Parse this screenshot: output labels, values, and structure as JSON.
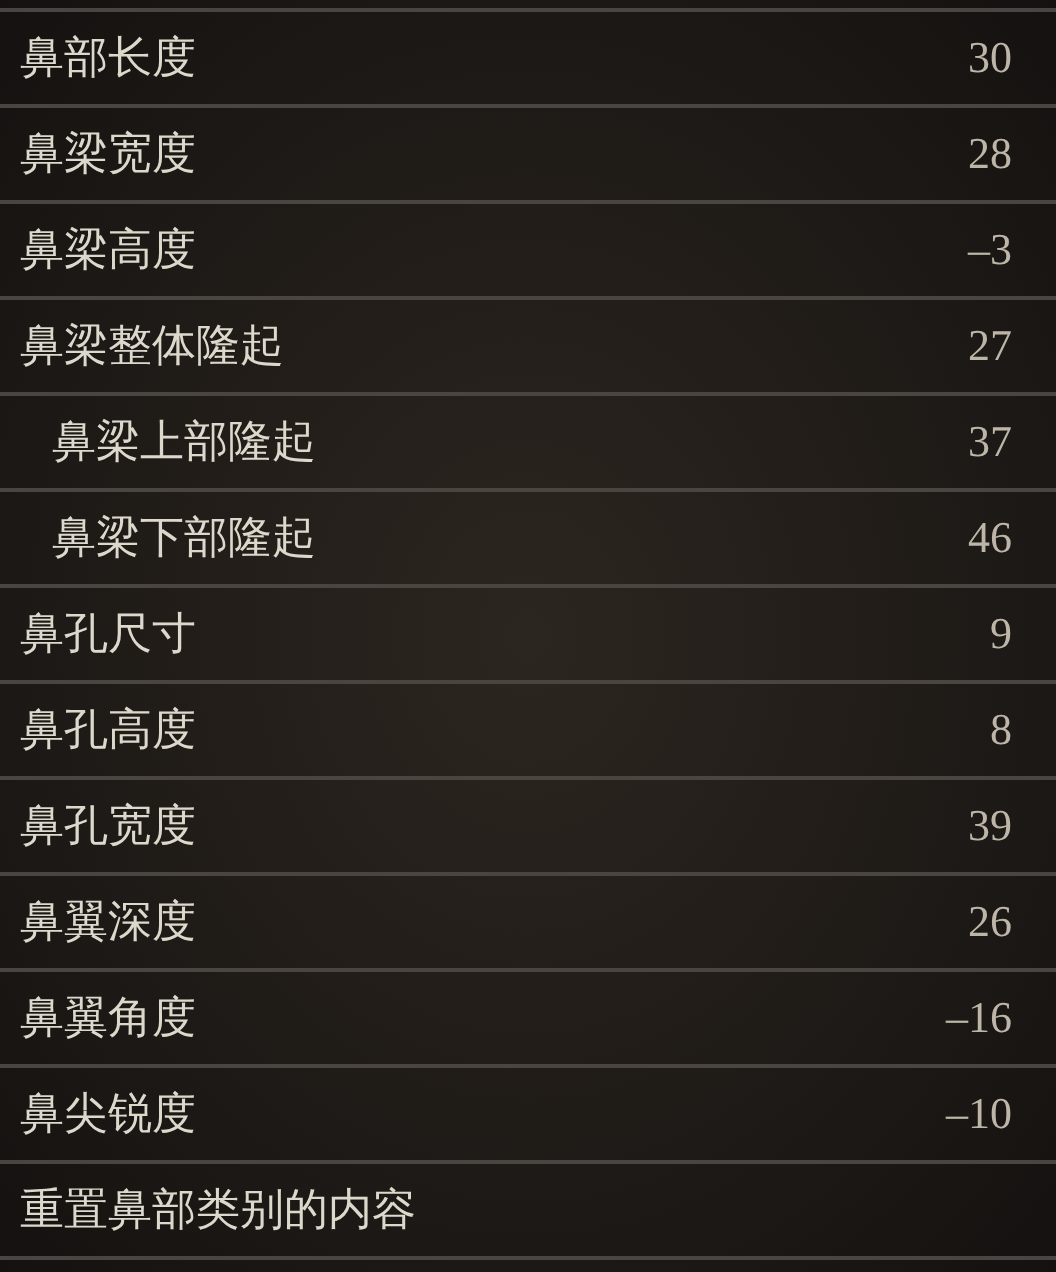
{
  "items": [
    {
      "kind": "setting",
      "label": "鼻部长度",
      "value": "30"
    },
    {
      "kind": "setting",
      "label": "鼻梁宽度",
      "value": "28"
    },
    {
      "kind": "setting",
      "label": "鼻梁高度",
      "value": "–3"
    },
    {
      "kind": "setting",
      "label": "鼻梁整体隆起",
      "value": "27",
      "children": [
        {
          "kind": "setting",
          "label": "鼻梁上部隆起",
          "value": "37"
        },
        {
          "kind": "setting",
          "label": "鼻梁下部隆起",
          "value": "46"
        }
      ]
    },
    {
      "kind": "setting",
      "label": "鼻孔尺寸",
      "value": "9"
    },
    {
      "kind": "setting",
      "label": "鼻孔高度",
      "value": "8"
    },
    {
      "kind": "setting",
      "label": "鼻孔宽度",
      "value": "39"
    },
    {
      "kind": "setting",
      "label": "鼻翼深度",
      "value": "26"
    },
    {
      "kind": "setting",
      "label": "鼻翼角度",
      "value": "–16"
    },
    {
      "kind": "setting",
      "label": "鼻尖锐度",
      "value": "–10"
    },
    {
      "kind": "action",
      "label": "重置鼻部类别的内容"
    }
  ]
}
